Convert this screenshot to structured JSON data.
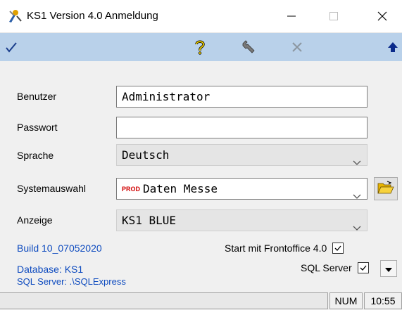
{
  "window": {
    "title": "KS1 Version 4.0 Anmeldung"
  },
  "toolbar": {
    "icons": [
      "check-icon",
      "help-icon",
      "wrench-icon",
      "cancel-icon",
      "arrow-up-icon"
    ]
  },
  "form": {
    "user_label": "Benutzer",
    "user_value": "Administrator",
    "password_label": "Passwort",
    "password_value": "",
    "language_label": "Sprache",
    "language_value": "Deutsch",
    "system_label": "Systemauswahl",
    "system_badge": "PROD",
    "system_value": "Daten Messe",
    "display_label": "Anzeige",
    "display_value": "KS1 BLUE"
  },
  "info": {
    "build": "Build 10_07052020",
    "database": "Database:   KS1",
    "sql_server": "SQL Server: .\\SQLExpress",
    "start_frontoffice_label": "Start mit Frontoffice 4.0",
    "start_frontoffice_checked": true,
    "sql_server_label": "SQL Server",
    "sql_server_checked": true
  },
  "statusbar": {
    "num": "NUM",
    "time": "10:55"
  },
  "colors": {
    "toolbar_bg": "#b9d1ea",
    "link_blue": "#0e4bbf",
    "prod_red": "#d10000"
  }
}
